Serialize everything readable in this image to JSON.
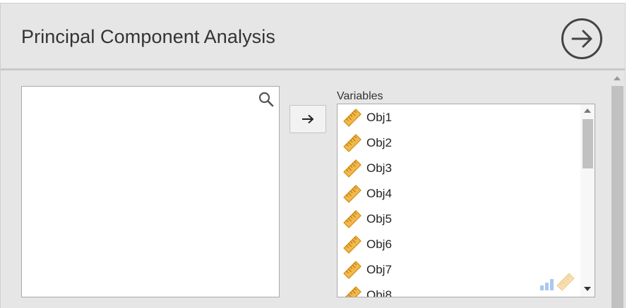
{
  "header": {
    "title": "Principal Component Analysis",
    "run_icon": "arrow-right-circle-icon"
  },
  "source": {
    "search_icon": "search-icon",
    "items": []
  },
  "move_button": {
    "icon": "arrow-right-icon",
    "symbol": "→"
  },
  "variables": {
    "label": "Variables",
    "items": [
      {
        "name": "Obj1",
        "type": "continuous"
      },
      {
        "name": "Obj2",
        "type": "continuous"
      },
      {
        "name": "Obj3",
        "type": "continuous"
      },
      {
        "name": "Obj4",
        "type": "continuous"
      },
      {
        "name": "Obj5",
        "type": "continuous"
      },
      {
        "name": "Obj6",
        "type": "continuous"
      },
      {
        "name": "Obj7",
        "type": "continuous"
      },
      {
        "name": "Obj8",
        "type": "continuous"
      }
    ],
    "allowed_type_icons": [
      "bar-chart-icon",
      "ruler-icon"
    ]
  },
  "colors": {
    "panel_bg": "#e6e6e6",
    "ruler_fill": "#f2b84b",
    "ruler_stroke": "#d18e14",
    "run_icon_stroke": "#444444"
  }
}
